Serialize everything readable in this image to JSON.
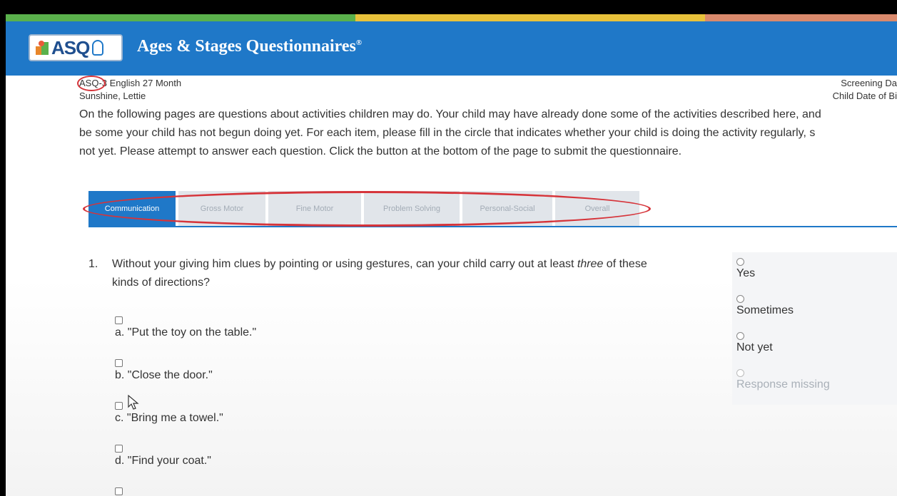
{
  "colors": {
    "header_bg": "#1f78c8",
    "active_tab": "#1f78c8",
    "inactive_tab": "#e1e5ea",
    "annotation": "#d6343a",
    "stripe": [
      "#5ab14c",
      "#e8c13b",
      "#d9896c"
    ]
  },
  "header": {
    "logo_text": "ASQ",
    "title": "Ages & Stages Questionnaires",
    "title_mark": "®"
  },
  "meta": {
    "questionnaire": "ASQ-3 English 27 Month",
    "child_name": "Sunshine, Lettie",
    "screening_label": "Screening Da",
    "dob_label": "Child Date of Bi"
  },
  "intro": {
    "line1": "On the following pages are questions about activities children may do. Your child may have already done some of the activities described here, and",
    "line2": "be some your child has not begun doing yet. For each item, please fill in the circle that indicates whether your child is doing the activity regularly, s",
    "line3": "not yet. Please attempt to answer each question. Click the button at the bottom of the page to submit the questionnaire."
  },
  "tabs": [
    {
      "label": "Communication",
      "active": true
    },
    {
      "label": "Gross Motor",
      "active": false
    },
    {
      "label": "Fine Motor",
      "active": false
    },
    {
      "label": "Problem Solving",
      "active": false
    },
    {
      "label": "Personal-Social",
      "active": false
    },
    {
      "label": "Overall",
      "active": false
    }
  ],
  "question": {
    "number": "1.",
    "text_before": "Without your giving him clues by pointing or using gestures, can your child carry out at least ",
    "text_emph": "three",
    "text_after": " of these",
    "text_line2": "kinds of directions?",
    "items": [
      "a. \"Put the toy on the table.\"",
      "b. \"Close the door.\"",
      "c. \"Bring me a towel.\"",
      "d. \"Find your coat.\""
    ]
  },
  "answers": [
    "Yes",
    "Sometimes",
    "Not yet",
    "Response missing"
  ],
  "icons": [
    "asq-logo-icon",
    "checkbox-icon",
    "radio-icon",
    "mouse-pointer-icon"
  ]
}
